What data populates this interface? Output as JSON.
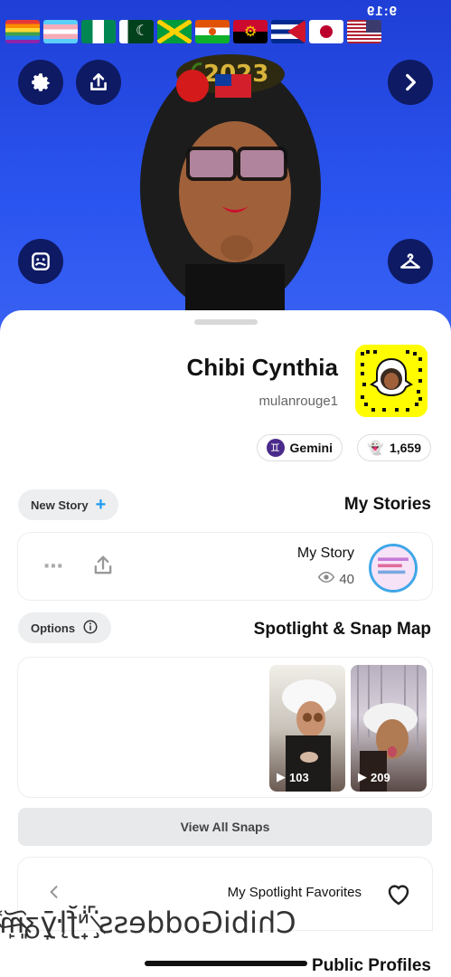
{
  "status": {
    "time": "9:19"
  },
  "header": {
    "flags": [
      "rainbow",
      "trans",
      "nigeria",
      "pakistan",
      "jamaica",
      "niger",
      "angola",
      "cuba",
      "japan",
      "usa"
    ],
    "buttons": {
      "settings": "gear-icon",
      "share": "upload-icon",
      "next": "chevron-right-icon",
      "sticker": "sticker-icon",
      "outfit": "hanger-icon"
    }
  },
  "profile": {
    "display_name": "Chibi Cynthia",
    "username": "mulanrouge1",
    "snapscore": "1,659",
    "zodiac": "Gemini",
    "zodiac_symbol": "♊"
  },
  "stories": {
    "title": "My Stories",
    "new_story_label": "New Story",
    "item": {
      "title": "My Story",
      "views": "40"
    }
  },
  "spotlight": {
    "title": "Spotlight & Snap Map",
    "options_label": "Options",
    "thumbs": [
      {
        "count": "209"
      },
      {
        "count": "103"
      }
    ],
    "view_all_label": "View All Snaps"
  },
  "favorites": {
    "label": "My Spotlight Favorites"
  },
  "overlay": {
    "text": "ChibiGoddess ̷̨̇̚ᶰ̟̇̍ƒ̯̐ŀ̧ȳ̞ᵹ̷͈͠ᵯ̘͐"
  },
  "public_profiles": {
    "title": "Public Profiles"
  },
  "colors": {
    "header_blue": "#2b55f0",
    "snap_yellow": "#fffc00",
    "accent_blue": "#3fa7e8",
    "button_navy": "#0e1a63"
  }
}
